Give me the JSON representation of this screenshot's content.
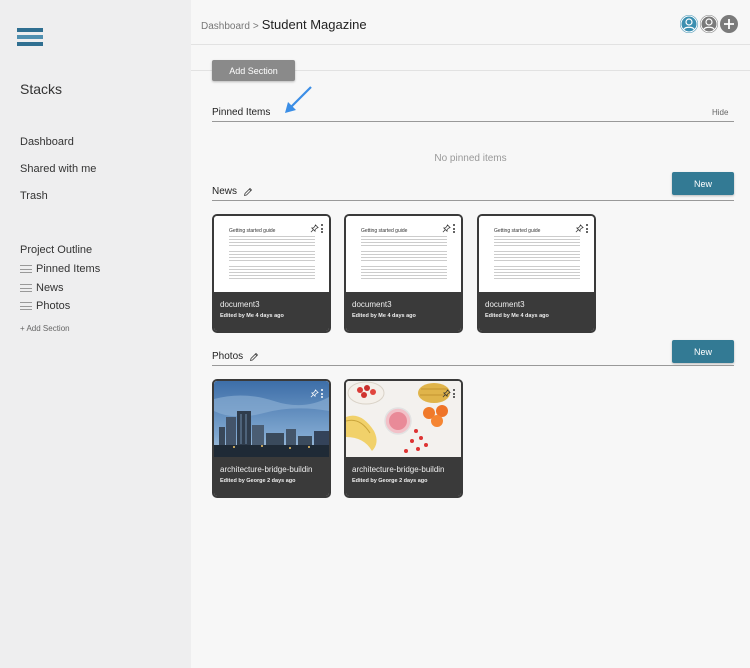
{
  "app": {
    "name": "Stacks"
  },
  "nav": {
    "items": [
      {
        "label": "Dashboard"
      },
      {
        "label": "Shared with me"
      },
      {
        "label": "Trash"
      }
    ]
  },
  "outline": {
    "title": "Project Outline",
    "items": [
      {
        "label": "Pinned Items"
      },
      {
        "label": "News"
      },
      {
        "label": "Photos"
      }
    ],
    "add_label": "+ Add Section"
  },
  "header": {
    "breadcrumb_parent": "Dashboard",
    "breadcrumb_sep": ">",
    "title": "Student Magazine"
  },
  "main": {
    "add_section_label": "Add Section",
    "pinned": {
      "title": "Pinned Items",
      "hide_label": "Hide",
      "empty_message": "No pinned items"
    },
    "news": {
      "title": "News",
      "new_label": "New",
      "cards": [
        {
          "doc_heading": "Getting started guide",
          "name": "document3",
          "meta": "Edited by Me 4 days ago"
        },
        {
          "doc_heading": "Getting started guide",
          "name": "document3",
          "meta": "Edited by Me 4 days ago"
        },
        {
          "doc_heading": "Getting started guide",
          "name": "document3",
          "meta": "Edited by Me 4 days ago"
        }
      ]
    },
    "photos": {
      "title": "Photos",
      "new_label": "New",
      "cards": [
        {
          "name": "architecture-bridge-buildin",
          "meta": "Edited by George 2 days ago"
        },
        {
          "name": "architecture-bridge-buildin",
          "meta": "Edited by George 2 days ago"
        }
      ]
    }
  },
  "colors": {
    "accent": "#337a94",
    "sidebar_bg": "#eeeeef",
    "card_footer": "#3a3a3a",
    "annotation_arrow": "#3b8ee6"
  }
}
